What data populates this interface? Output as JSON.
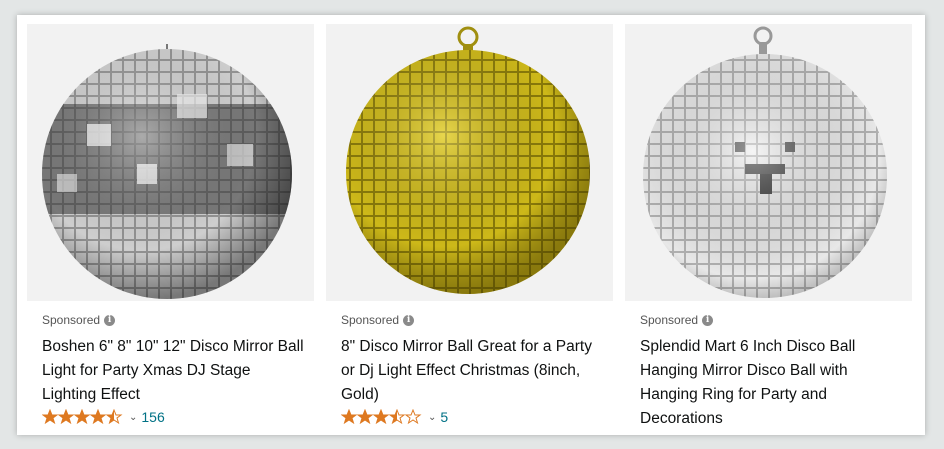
{
  "products": [
    {
      "sponsored": "Sponsored",
      "title": "Boshen 6\" 8\" 10\" 12\" Disco Mirror Ball Light for Party Xmas DJ Stage Lighting Effect",
      "rating": 4.5,
      "review_count": "156",
      "ball_color": "silver"
    },
    {
      "sponsored": "Sponsored",
      "title": "8\" Disco Mirror Ball Great for a Party or Dj Light Effect Christmas (8inch, Gold)",
      "rating": 3.5,
      "review_count": "5",
      "ball_color": "gold"
    },
    {
      "sponsored": "Sponsored",
      "title": "Splendid Mart 6 Inch Disco Ball Hanging Mirror Disco Ball with Hanging Ring for Party and Decorations",
      "ball_color": "white-silver"
    }
  ],
  "colors": {
    "star": "#de7921",
    "link": "#007185",
    "gold_ball": "#d8c21a"
  }
}
